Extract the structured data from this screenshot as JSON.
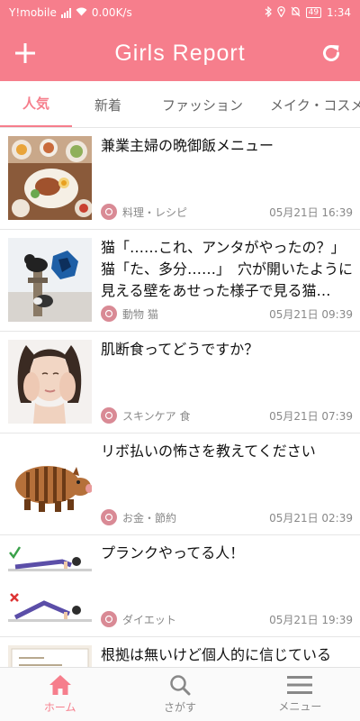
{
  "status_bar": {
    "carrier": "Y!mobile",
    "speed": "0.00K/s",
    "battery": "49",
    "time": "1:34"
  },
  "app_bar": {
    "title": "Girls Report"
  },
  "tabs": [
    {
      "label": "人気",
      "active": true
    },
    {
      "label": "新着",
      "active": false
    },
    {
      "label": "ファッション",
      "active": false
    },
    {
      "label": "メイク・コスメ",
      "active": false
    }
  ],
  "articles": [
    {
      "title": "兼業主婦の晩御飯メニュー",
      "category": "料理・レシピ",
      "date": "05月21日 16:39",
      "thumb": "dinner-photo"
    },
    {
      "title": "猫「……これ、アンタがやったの？」猫「た、多分……」　穴が開いたように見える壁をあせった様子で見る猫…",
      "category": "動物 猫",
      "date": "05月21日 09:39",
      "thumb": "cats-wall-photo"
    },
    {
      "title": "肌断食ってどうですか？",
      "category": "スキンケア 食",
      "date": "05月21日 07:39",
      "thumb": "woman-face-photo"
    },
    {
      "title": "リボ払いの怖さを教えてください",
      "category": "お金・節約",
      "date": "05月21日 02:39",
      "thumb": "boar-illustration"
    },
    {
      "title": "プランクやってる人！",
      "category": "ダイエット",
      "date": "05月21日 19:39",
      "thumb": "plank-illustration"
    },
    {
      "title": "根拠は無いけど個人的に信じている",
      "category": "",
      "date": "",
      "thumb": "partial-photo"
    }
  ],
  "bottom_nav": [
    {
      "label": "ホーム",
      "icon": "home-icon",
      "active": true
    },
    {
      "label": "さがす",
      "icon": "search-icon",
      "active": false
    },
    {
      "label": "メニュー",
      "icon": "menu-icon",
      "active": false
    }
  ],
  "colors": {
    "brand": "#f67e8c",
    "category_icon": "#d98a95"
  }
}
